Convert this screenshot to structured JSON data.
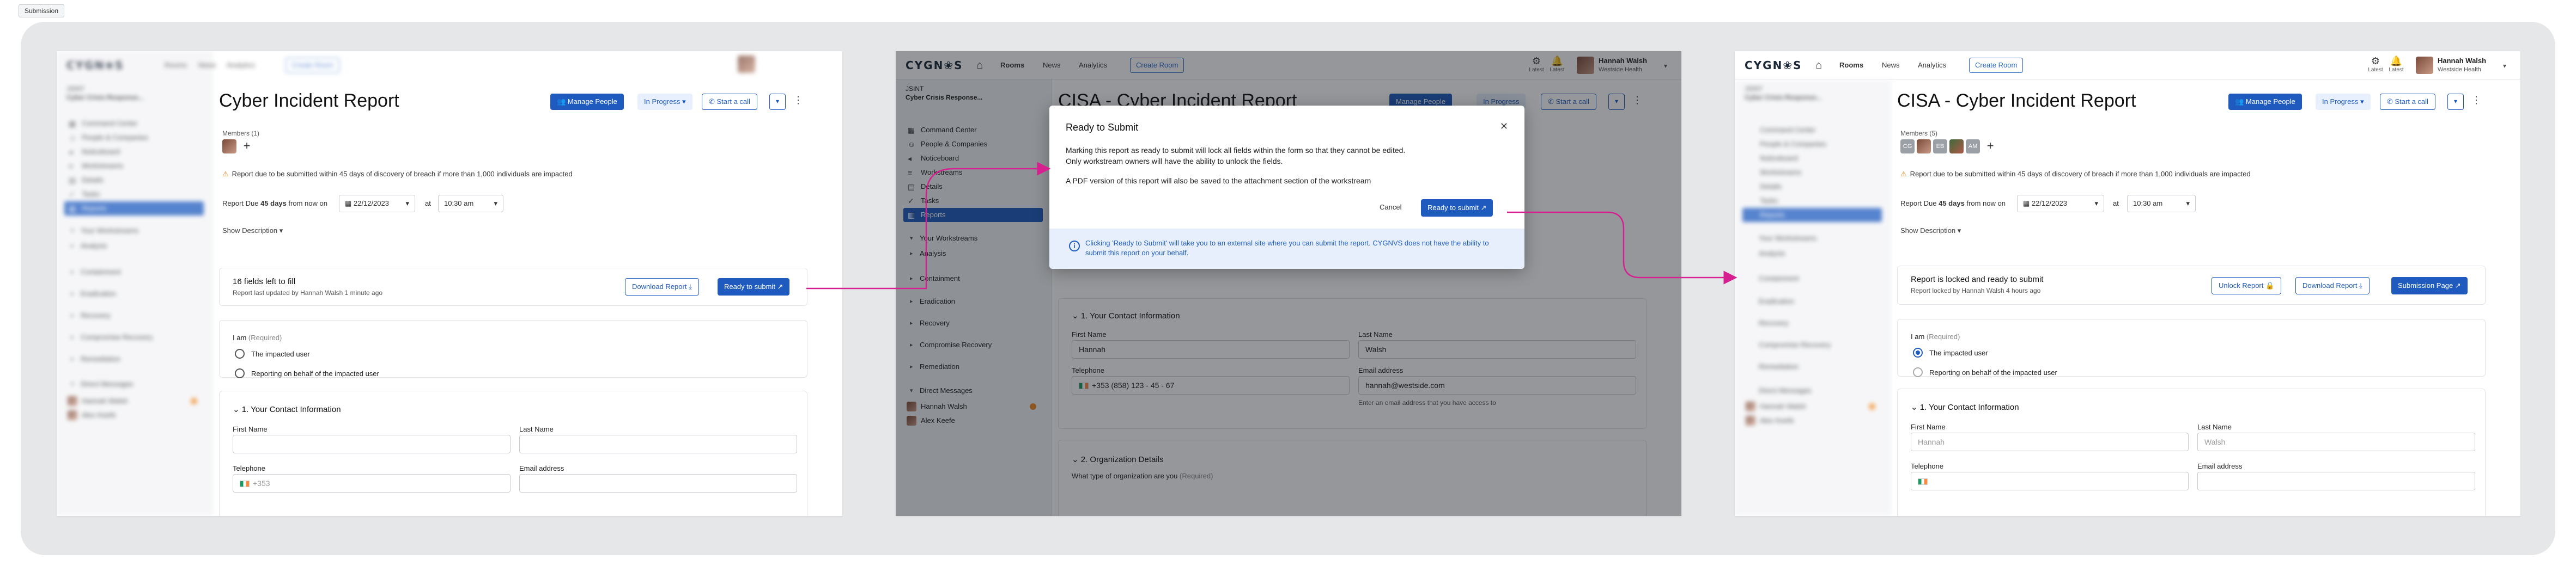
{
  "label": "Submission",
  "app": {
    "logo": "CYGN❀S",
    "nav": [
      "Rooms",
      "News",
      "Analytics"
    ],
    "create_room": "Create Room",
    "alert_labels": [
      "Latest",
      "Latest"
    ],
    "user": {
      "name": "Hannah Walsh",
      "org": "Westside Health"
    }
  },
  "sidebar": {
    "case_id": "JSINT",
    "room": "Cyber Crisis Response...",
    "items": [
      "Command Center",
      "People & Companies",
      "Noticeboard",
      "Workstreams",
      "Details",
      "Tasks",
      "Reports"
    ],
    "your_workstreams": "Your Workstreams",
    "groups": [
      "Analysis",
      "Containment",
      "Eradication",
      "Recovery",
      "Compromise Recovery",
      "Remediation"
    ],
    "dm_title": "Direct Messages",
    "dms": [
      "Hannah Walsh",
      "Alex Keefe"
    ]
  },
  "screen1": {
    "title": "Cyber Incident Report",
    "members_label": "Members (1)",
    "manage_people": "Manage People",
    "status": "In Progress",
    "start_call": "Start a call",
    "warning": "Report due to be submitted within 45 days of discovery of breach if more than 1,000 individuals are impacted",
    "due_prefix": "Report Due ",
    "due_bold": "45 days",
    "due_suffix": " from now on",
    "date": "22/12/2023",
    "at": "at",
    "time": "10:30 am",
    "show_description": "Show Description",
    "card_title": "16 fields left to fill",
    "card_sub": "Report last updated by Hannah Walsh 1 minute ago",
    "download": "Download Report",
    "ready": "Ready to submit",
    "i_am": "I am",
    "required": "(Required)",
    "radio1": "The impacted user",
    "radio2": "Reporting on behalf of the impacted user",
    "section": "1. Your Contact Information",
    "first_name": "First Name",
    "last_name": "Last Name",
    "telephone": "Telephone",
    "email": "Email address",
    "tel_value": "+353"
  },
  "screen2": {
    "bg_title": "CISA - Cyber Incident Report",
    "bg_manage": "Manage People",
    "bg_status": "In Progress",
    "bg_call": "Start a call",
    "section1": "1. Your Contact Information",
    "first_name": "First Name",
    "first_value": "Hannah",
    "last_name": "Last Name",
    "last_value": "Walsh",
    "telephone": "Telephone",
    "tel_value": "+353 (858) 123 - 45 - 67",
    "email": "Email address",
    "email_value": "hannah@westside.com",
    "email_help": "Enter an email address that you have access to",
    "section2": "2. Organization Details",
    "org_q": "What type of organization are you",
    "required": "(Required)",
    "modal": {
      "title": "Ready to Submit",
      "line1": "Marking this report as ready to submit will lock all fields within the form so that they cannot be edited.",
      "line2": "Only workstream owners will have the ability to unlock the fields.",
      "line3": "A PDF version of this report will also be saved to the attachment section of the workstream",
      "cancel": "Cancel",
      "confirm": "Ready to submit",
      "info": "Clicking 'Ready to Submit' will take you to an external site where you can submit the report. CYGNVS does not have the ability to submit this report on your behalf."
    }
  },
  "screen3": {
    "title": "CISA - Cyber Incident Report",
    "members_label": "Members (5)",
    "member_initials": [
      "CG",
      "EB",
      "AM"
    ],
    "manage_people": "Manage People",
    "status": "In Progress",
    "start_call": "Start a call",
    "warning": "Report due to be submitted within 45 days of discovery of breach if more than 1,000 individuals are impacted",
    "due_prefix": "Report Due ",
    "due_bold": "45 days",
    "due_suffix": " from now on",
    "date": "22/12/2023",
    "at": "at",
    "time": "10:30 am",
    "show_description": "Show Description",
    "card_title": "Report is locked and ready to submit",
    "card_sub": "Report locked by Hannah Walsh 4 hours ago",
    "unlock": "Unlock Report",
    "download": "Download Report",
    "submission_page": "Submission Page",
    "i_am": "I am",
    "required": "(Required)",
    "radio1": "The impacted user",
    "radio2": "Reporting on behalf of the impacted user",
    "section": "1. Your Contact Information",
    "first_name": "First Name",
    "first_ph": "Hannah",
    "last_name": "Last Name",
    "last_ph": "Walsh",
    "telephone": "Telephone",
    "email": "Email address"
  },
  "colors": {
    "primary": "#1f5bbf",
    "arrow": "#d6208f",
    "warning": "#e8801c"
  }
}
